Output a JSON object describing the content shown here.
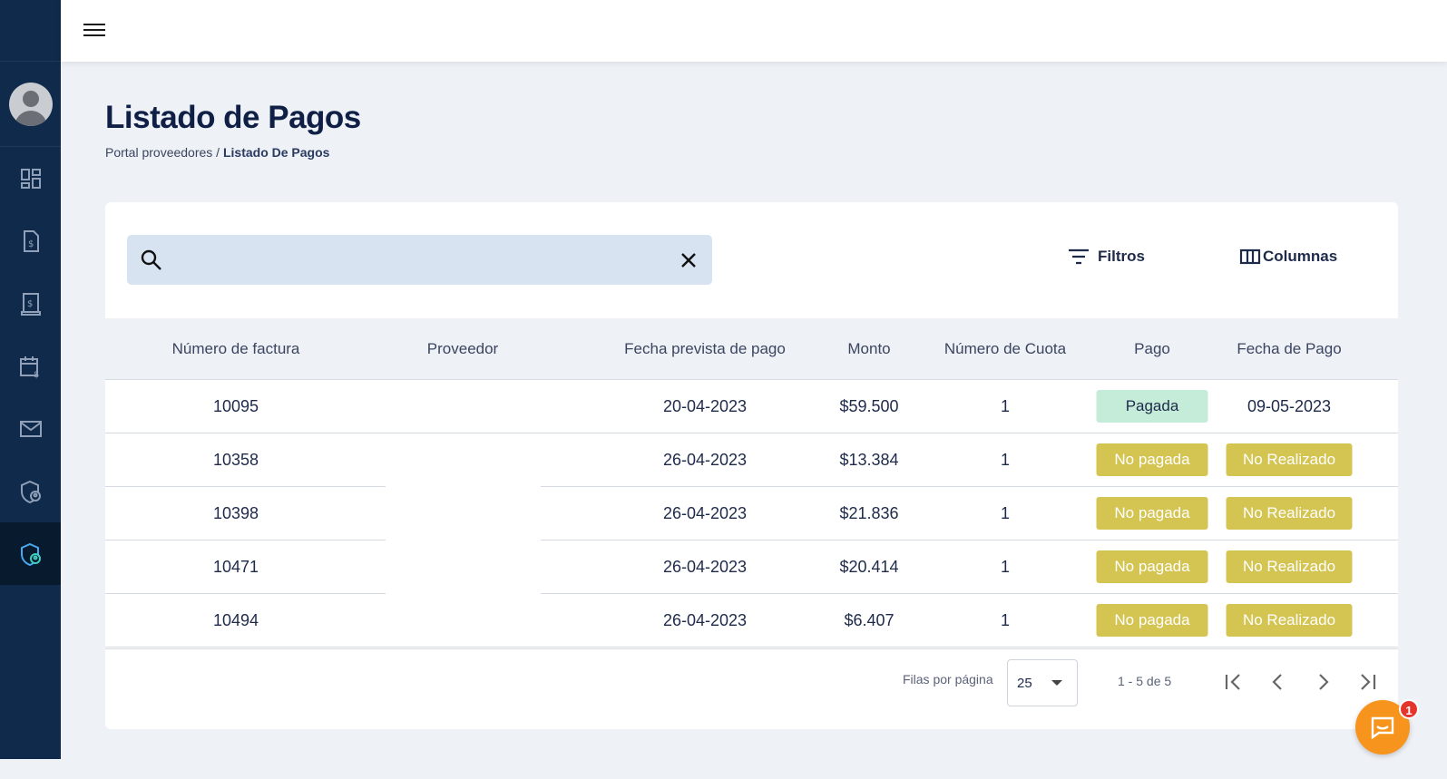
{
  "page": {
    "title": "Listado de Pagos",
    "breadcrumb": {
      "root": "Portal proveedores",
      "separator": " / ",
      "current": "Listado De Pagos"
    }
  },
  "sidebar": {
    "items": [
      {
        "icon": "dashboard-icon"
      },
      {
        "icon": "invoice-icon"
      },
      {
        "icon": "receipt-icon"
      },
      {
        "icon": "calendar-money-icon"
      },
      {
        "icon": "mail-icon"
      },
      {
        "icon": "shield-user-icon"
      },
      {
        "icon": "shield-user-active-icon",
        "active": true
      }
    ]
  },
  "toolbar": {
    "search_placeholder": "",
    "filters_label": "Filtros",
    "columns_label": "Columnas"
  },
  "table": {
    "headers": [
      "Número de factura",
      "Proveedor",
      "Fecha prevista de pago",
      "Monto",
      "Número de Cuota",
      "Pago",
      "Fecha de Pago"
    ],
    "rows": [
      {
        "invoice": "10095",
        "provider": "",
        "due_date": "20-04-2023",
        "amount": "$59.500",
        "installment": "1",
        "payment": "Pagada",
        "payment_date": "09-05-2023"
      },
      {
        "invoice": "10358",
        "provider": "",
        "due_date": "26-04-2023",
        "amount": "$13.384",
        "installment": "1",
        "payment": "No pagada",
        "payment_date": "No Realizado"
      },
      {
        "invoice": "10398",
        "provider": "",
        "due_date": "26-04-2023",
        "amount": "$21.836",
        "installment": "1",
        "payment": "No pagada",
        "payment_date": "No Realizado"
      },
      {
        "invoice": "10471",
        "provider": "",
        "due_date": "26-04-2023",
        "amount": "$20.414",
        "installment": "1",
        "payment": "No pagada",
        "payment_date": "No Realizado"
      },
      {
        "invoice": "10494",
        "provider": "",
        "due_date": "26-04-2023",
        "amount": "$6.407",
        "installment": "1",
        "payment": "No pagada",
        "payment_date": "No Realizado"
      }
    ]
  },
  "pagination": {
    "rows_per_page_label": "Filas por página",
    "rows_per_page": "25",
    "range": "1 - 5 de 5"
  },
  "chat": {
    "badge_count": "1"
  },
  "colors": {
    "sidebar": "#0f2a4a",
    "paid_badge": "#c5ecd9",
    "unpaid_badge": "#d4c451",
    "chat": "#f7941d"
  }
}
